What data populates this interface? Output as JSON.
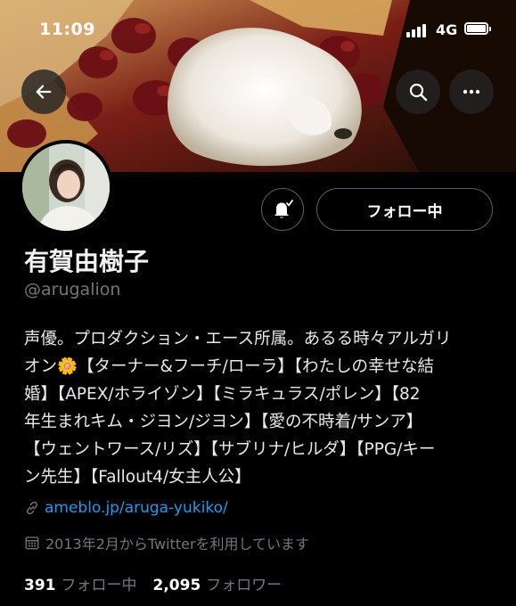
{
  "status_bar": {
    "time": "11:09",
    "network": "4G"
  },
  "profile": {
    "display_name": "有賀由樹子",
    "handle": "@arugalion",
    "bio_lines": [
      "声優。プロダクション・エース所属。あるる時々アルガリ",
      "オン🌼【ターナー&フーチ/ローラ】【わたしの幸せな結",
      "婚】【APEX/ホライゾン】【ミラキュラス/ポレン】【82",
      "年生まれキム・ジヨン/ジヨン】【愛の不時着/サンア】",
      "【ウェントワース/リズ】【サブリナ/ヒルダ】【PPG/キー",
      "ン先生】【Fallout4/女主人公】"
    ],
    "website": "ameblo.jp/aruga-yukiko/",
    "joined": "2013年2月からTwitterを利用しています",
    "following_count": "391",
    "following_label": "フォロー中",
    "followers_count": "2,095",
    "followers_label": "フォロワー"
  },
  "actions": {
    "follow_button_label": "フォロー中"
  },
  "icons": [
    "back-arrow-icon",
    "search-icon",
    "more-icon",
    "notification-bell-icon",
    "link-icon",
    "calendar-icon"
  ]
}
